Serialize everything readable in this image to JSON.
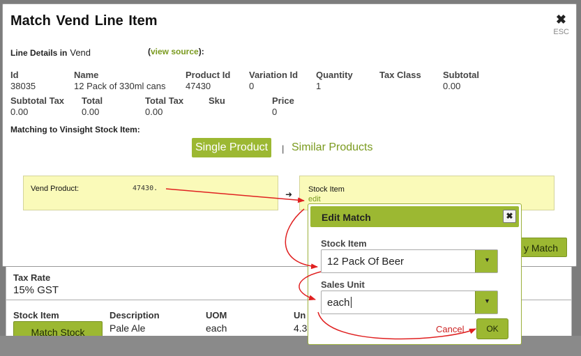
{
  "modal": {
    "title": "Match Vend Line Item",
    "close_glyph": "✖",
    "esc_label": "ESC"
  },
  "line_details": {
    "label": "Line Details in",
    "source_name": "Vend",
    "view_source_open": "(",
    "view_source_link": "view source",
    "view_source_close": "):",
    "fields": [
      {
        "header": "Id",
        "value": "38035"
      },
      {
        "header": "Name",
        "value": "12 Pack of 330ml cans"
      },
      {
        "header": "Product Id",
        "value": "47430"
      },
      {
        "header": "Variation Id",
        "value": "0"
      },
      {
        "header": "Quantity",
        "value": "1"
      },
      {
        "header": "Tax Class",
        "value": ""
      },
      {
        "header": "Subtotal",
        "value": "0.00"
      },
      {
        "header": "Subtotal Tax",
        "value": "0.00"
      },
      {
        "header": "Total",
        "value": "0.00"
      },
      {
        "header": "Total Tax",
        "value": "0.00"
      },
      {
        "header": "Sku",
        "value": ""
      },
      {
        "header": "Price",
        "value": "0"
      }
    ]
  },
  "matching": {
    "title": "Matching to Vinsight Stock Item:",
    "tabs": {
      "single": "Single Product",
      "separator": "|",
      "similar": "Similar Products"
    },
    "vend_label": "Vend Product:",
    "vend_product_id": "47430.",
    "arrow": "➜",
    "stock_label": "Stock Item",
    "edit_link": "edit",
    "create_button_label": "y Match"
  },
  "edit_match": {
    "title": "Edit Match",
    "close_glyph": "✖",
    "stock_item_label": "Stock Item",
    "stock_item_value": "12 Pack Of Beer",
    "sales_unit_label": "Sales Unit",
    "sales_unit_value": "each",
    "caret": "▼",
    "cancel_label": "Cancel",
    "ok_label": "OK"
  },
  "background": {
    "tax_rate_label": "Tax Rate",
    "tax_rate_value": "15% GST",
    "columns": [
      {
        "header": "Stock Item",
        "value": ""
      },
      {
        "header": "Description",
        "value": "Pale Ale"
      },
      {
        "header": "UOM",
        "value": "each"
      },
      {
        "header": "Un",
        "value": "4.3"
      }
    ],
    "match_stock_label": "Match Stock"
  },
  "colors": {
    "accent": "#9cb832",
    "link": "#7a9a1e",
    "box": "#fafab9",
    "annotation": "#e02020"
  }
}
